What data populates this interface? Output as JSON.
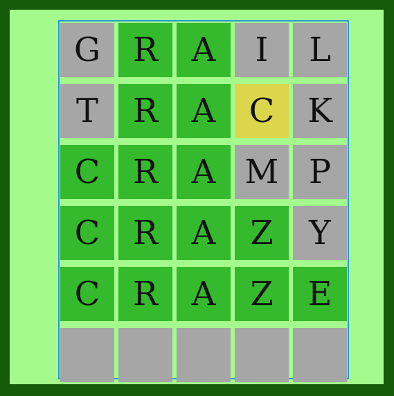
{
  "colors": {
    "outer_border": "#165b0a",
    "background": "#a4fa8d",
    "board_border": "#2a98d8",
    "correct": "#34ba2c",
    "present": "#dcd64c",
    "absent": "#a6a6a6"
  },
  "board": {
    "rows": [
      {
        "word": "GRAIL",
        "tiles": [
          {
            "letter": "G",
            "state": "absent"
          },
          {
            "letter": "R",
            "state": "correct"
          },
          {
            "letter": "A",
            "state": "correct"
          },
          {
            "letter": "I",
            "state": "absent"
          },
          {
            "letter": "L",
            "state": "absent"
          }
        ]
      },
      {
        "word": "TRACK",
        "tiles": [
          {
            "letter": "T",
            "state": "absent"
          },
          {
            "letter": "R",
            "state": "correct"
          },
          {
            "letter": "A",
            "state": "correct"
          },
          {
            "letter": "C",
            "state": "present"
          },
          {
            "letter": "K",
            "state": "absent"
          }
        ]
      },
      {
        "word": "CRAMP",
        "tiles": [
          {
            "letter": "C",
            "state": "correct"
          },
          {
            "letter": "R",
            "state": "correct"
          },
          {
            "letter": "A",
            "state": "correct"
          },
          {
            "letter": "M",
            "state": "absent"
          },
          {
            "letter": "P",
            "state": "absent"
          }
        ]
      },
      {
        "word": "CRAZY",
        "tiles": [
          {
            "letter": "C",
            "state": "correct"
          },
          {
            "letter": "R",
            "state": "correct"
          },
          {
            "letter": "A",
            "state": "correct"
          },
          {
            "letter": "Z",
            "state": "correct"
          },
          {
            "letter": "Y",
            "state": "absent"
          }
        ]
      },
      {
        "word": "CRAZE",
        "tiles": [
          {
            "letter": "C",
            "state": "correct"
          },
          {
            "letter": "R",
            "state": "correct"
          },
          {
            "letter": "A",
            "state": "correct"
          },
          {
            "letter": "Z",
            "state": "correct"
          },
          {
            "letter": "E",
            "state": "correct"
          }
        ]
      },
      {
        "word": "",
        "tiles": [
          {
            "letter": "",
            "state": "empty"
          },
          {
            "letter": "",
            "state": "empty"
          },
          {
            "letter": "",
            "state": "empty"
          },
          {
            "letter": "",
            "state": "empty"
          },
          {
            "letter": "",
            "state": "empty"
          }
        ]
      }
    ]
  }
}
